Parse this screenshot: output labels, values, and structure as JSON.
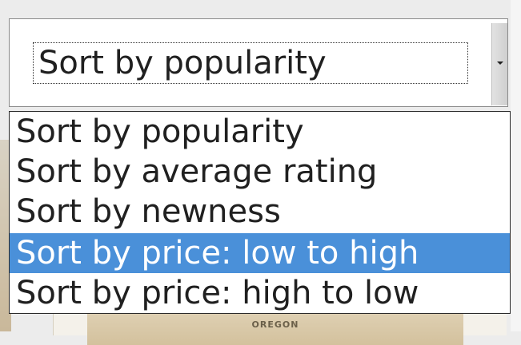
{
  "select": {
    "value": "Sort by popularity",
    "arrow_icon": "chevron-down-icon",
    "options": [
      {
        "label": "Sort by popularity",
        "highlighted": false
      },
      {
        "label": "Sort by average rating",
        "highlighted": false
      },
      {
        "label": "Sort by newness",
        "highlighted": false
      },
      {
        "label": "Sort by price: low to high",
        "highlighted": true
      },
      {
        "label": "Sort by price: high to low",
        "highlighted": false
      }
    ]
  },
  "background": {
    "product_brand": "OREGON"
  },
  "colors": {
    "highlight": "#4a90d9",
    "highlight_text": "#ffffff",
    "text": "#202020"
  }
}
